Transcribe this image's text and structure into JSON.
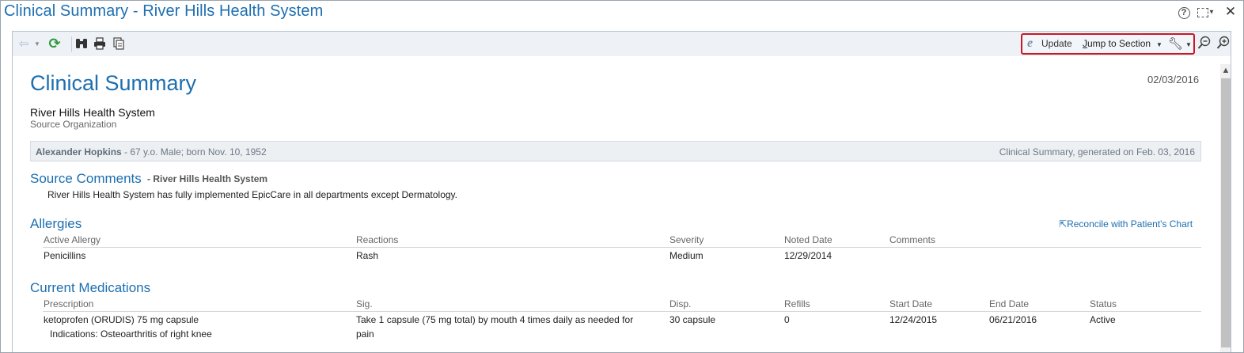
{
  "window": {
    "title": "Clinical Summary - River Hills Health System"
  },
  "toolbar": {
    "update_label": "Update",
    "jump_label_accel": "J",
    "jump_label_rest": "ump to Section",
    "icons": [
      "back-icon",
      "refresh-icon",
      "find-icon",
      "print-icon",
      "copy-icon",
      "wrench-icon",
      "zoom-out-icon",
      "zoom-in-icon"
    ]
  },
  "document": {
    "title": "Clinical Summary",
    "date": "02/03/2016",
    "org_name": "River Hills Health System",
    "org_caption": "Source Organization",
    "patient": {
      "name": "Alexander Hopkins",
      "details": " - 67 y.o. Male; born Nov. 10, 1952",
      "generated": "Clinical Summary, generated on Feb. 03, 2016"
    },
    "source_comments": {
      "heading": "Source Comments",
      "subheading": "- River Hills Health System",
      "text": "River Hills Health System has fully implemented EpicCare in all departments except Dermatology."
    },
    "allergies": {
      "heading": "Allergies",
      "reconcile_label": "Reconcile with Patient's Chart",
      "columns": [
        "Active Allergy",
        "Reactions",
        "Severity",
        "Noted Date",
        "Comments"
      ],
      "rows": [
        [
          "Penicillins",
          "Rash",
          "Medium",
          "12/29/2014",
          ""
        ]
      ]
    },
    "medications": {
      "heading": "Current Medications",
      "columns": [
        "Prescription",
        "Sig.",
        "Disp.",
        "Refills",
        "Start Date",
        "End Date",
        "Status"
      ],
      "rows": [
        {
          "prescription": "ketoprofen (ORUDIS) 75 mg capsule",
          "indication": "Indications: Osteoarthritis of right knee",
          "sig_line1": "Take 1 capsule (75 mg total) by mouth 4 times daily as needed for",
          "sig_line2": "pain",
          "disp": "30 capsule",
          "refills": "0",
          "start": "12/24/2015",
          "end": "06/21/2016",
          "status": "Active"
        }
      ]
    }
  },
  "colors": {
    "accent": "#1d6fb0",
    "highlight_border": "#c81824",
    "refresh_green": "#2e9a3e"
  }
}
